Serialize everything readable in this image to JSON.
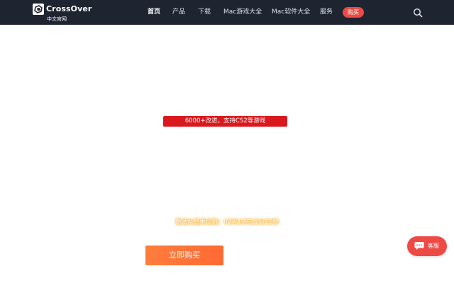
{
  "header": {
    "brand": {
      "name": "CrossOver",
      "subtitle": "中文官网",
      "icon": "crossover-logo-icon"
    },
    "nav": [
      {
        "label": "首页",
        "active": true
      },
      {
        "label": "产品",
        "active": false
      },
      {
        "label": "下载",
        "active": false
      },
      {
        "label": "Mac游戏大全",
        "active": false
      },
      {
        "label": "Mac软件大全",
        "active": false
      },
      {
        "label": "服务",
        "active": false
      }
    ],
    "buy_label": "购买",
    "search_icon": "search-icon"
  },
  "main": {
    "promo_banner": "6000+改进，支持CS2等游戏",
    "countdown": "距活动结束仅剩：03天19时22分22秒",
    "buy_now_label": "立即购买"
  },
  "service": {
    "label": "客服",
    "icon": "chat-bubble-icon"
  },
  "colors": {
    "header_bg": "#1f2431",
    "accent_red": "#ee4a45",
    "banner_red": "#d9191e",
    "buy_orange": "#ff7d3c",
    "countdown_glow": "#ffb23a"
  }
}
